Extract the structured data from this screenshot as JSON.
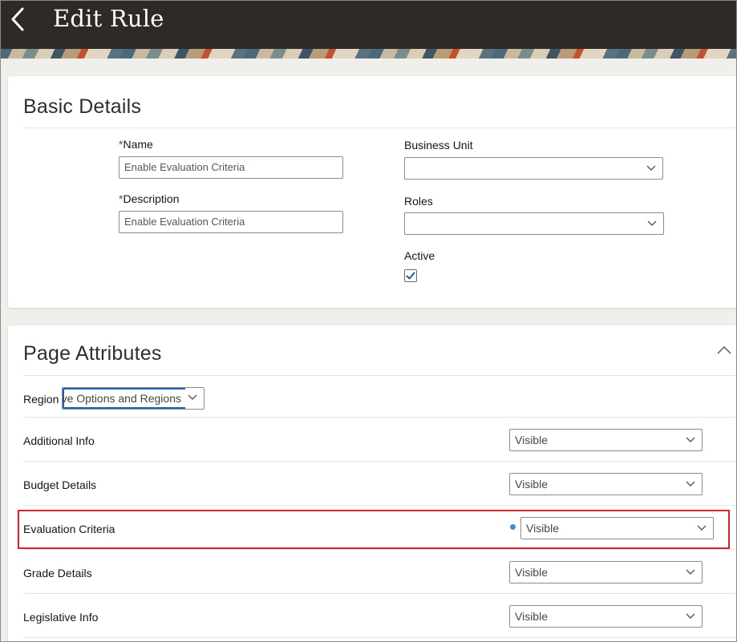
{
  "header": {
    "title": "Edit Rule",
    "back_icon": "chevron-left-icon"
  },
  "basic_details": {
    "title": "Basic Details",
    "name": {
      "required_marker": "*",
      "label": "Name",
      "value": "Enable Evaluation Criteria"
    },
    "description": {
      "required_marker": "*",
      "label": "Description",
      "value": "Enable Evaluation Criteria"
    },
    "business_unit": {
      "label": "Business Unit",
      "value": ""
    },
    "roles": {
      "label": "Roles",
      "value": ""
    },
    "active": {
      "label": "Active",
      "checked": true
    }
  },
  "page_attributes": {
    "title": "Page Attributes",
    "region": {
      "label": "Region",
      "value": "ve Options and Regions"
    },
    "rows": [
      {
        "label": "Additional Info",
        "value": "Visible"
      },
      {
        "label": "Budget Details",
        "value": "Visible"
      },
      {
        "label": "Evaluation Criteria",
        "value": "Visible",
        "modified": true
      },
      {
        "label": "Grade Details",
        "value": "Visible"
      },
      {
        "label": "Legislative Info",
        "value": "Visible"
      }
    ]
  },
  "colors": {
    "header_bg": "#2d2a27",
    "accent_blue": "#1f5fb5",
    "highlight_red": "#d2232a",
    "checkbox_blue": "#1a5ea8"
  }
}
